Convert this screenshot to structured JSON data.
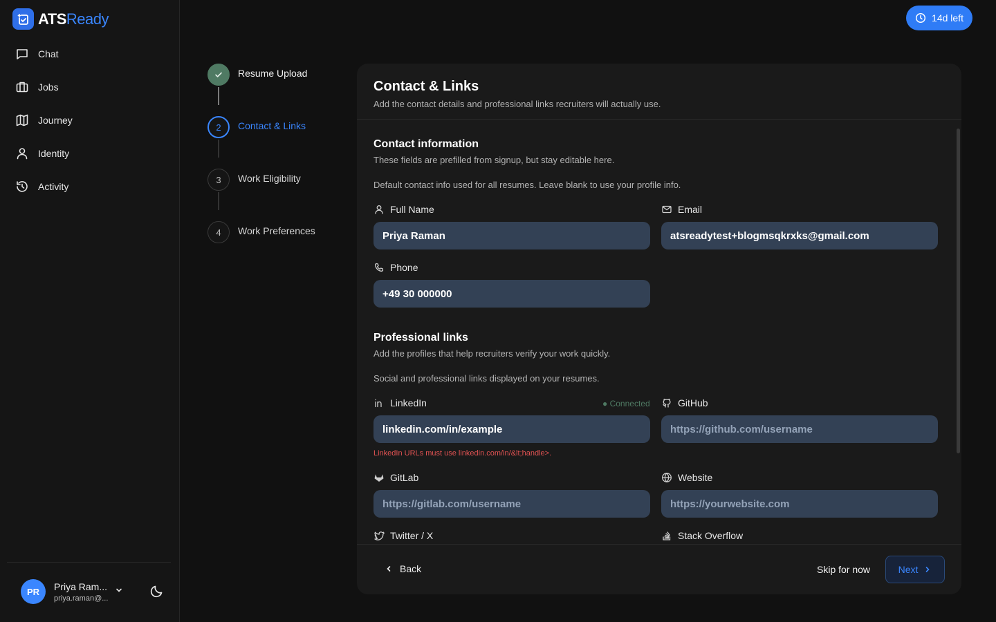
{
  "brand": {
    "name_part1": "ATS",
    "name_part2": "Ready"
  },
  "nav": [
    {
      "label": "Chat",
      "icon": "chat-icon"
    },
    {
      "label": "Jobs",
      "icon": "briefcase-icon"
    },
    {
      "label": "Journey",
      "icon": "map-icon"
    },
    {
      "label": "Identity",
      "icon": "user-icon"
    },
    {
      "label": "Activity",
      "icon": "history-icon"
    }
  ],
  "user": {
    "initials": "PR",
    "name": "Priya Ram...",
    "email": "priya.raman@..."
  },
  "timer": {
    "label": "14d left"
  },
  "steps": [
    {
      "number": "1",
      "label": "Resume Upload",
      "state": "done"
    },
    {
      "number": "2",
      "label": "Contact & Links",
      "state": "active"
    },
    {
      "number": "3",
      "label": "Work Eligibility",
      "state": "pending"
    },
    {
      "number": "4",
      "label": "Work Preferences",
      "state": "pending"
    }
  ],
  "card": {
    "title": "Contact & Links",
    "subtitle": "Add the contact details and professional links recruiters will actually use."
  },
  "contact": {
    "title": "Contact information",
    "subtitle": "These fields are prefilled from signup, but stay editable here.",
    "note": "Default contact info used for all resumes. Leave blank to use your profile info.",
    "full_name": {
      "label": "Full Name",
      "value": "Priya Raman"
    },
    "email": {
      "label": "Email",
      "value": "atsreadytest+blogmsqkrxks@gmail.com"
    },
    "phone": {
      "label": "Phone",
      "value": "+49 30 000000"
    }
  },
  "links": {
    "title": "Professional links",
    "subtitle": "Add the profiles that help recruiters verify your work quickly.",
    "note": "Social and professional links displayed on your resumes.",
    "linkedin": {
      "label": "LinkedIn",
      "value": "linkedin.com/in/example",
      "status": "Connected",
      "error": "LinkedIn URLs must use linkedin.com/in/&lt;handle>."
    },
    "github": {
      "label": "GitHub",
      "placeholder": "https://github.com/username"
    },
    "gitlab": {
      "label": "GitLab",
      "placeholder": "https://gitlab.com/username"
    },
    "website": {
      "label": "Website",
      "placeholder": "https://yourwebsite.com"
    },
    "twitter": {
      "label": "Twitter / X"
    },
    "stackoverflow": {
      "label": "Stack Overflow"
    }
  },
  "footer": {
    "back": "Back",
    "skip": "Skip for now",
    "next": "Next"
  },
  "colors": {
    "accent": "#3a86ff",
    "done": "#4f7a63",
    "input_bg": "#334155",
    "error": "#e05252"
  }
}
